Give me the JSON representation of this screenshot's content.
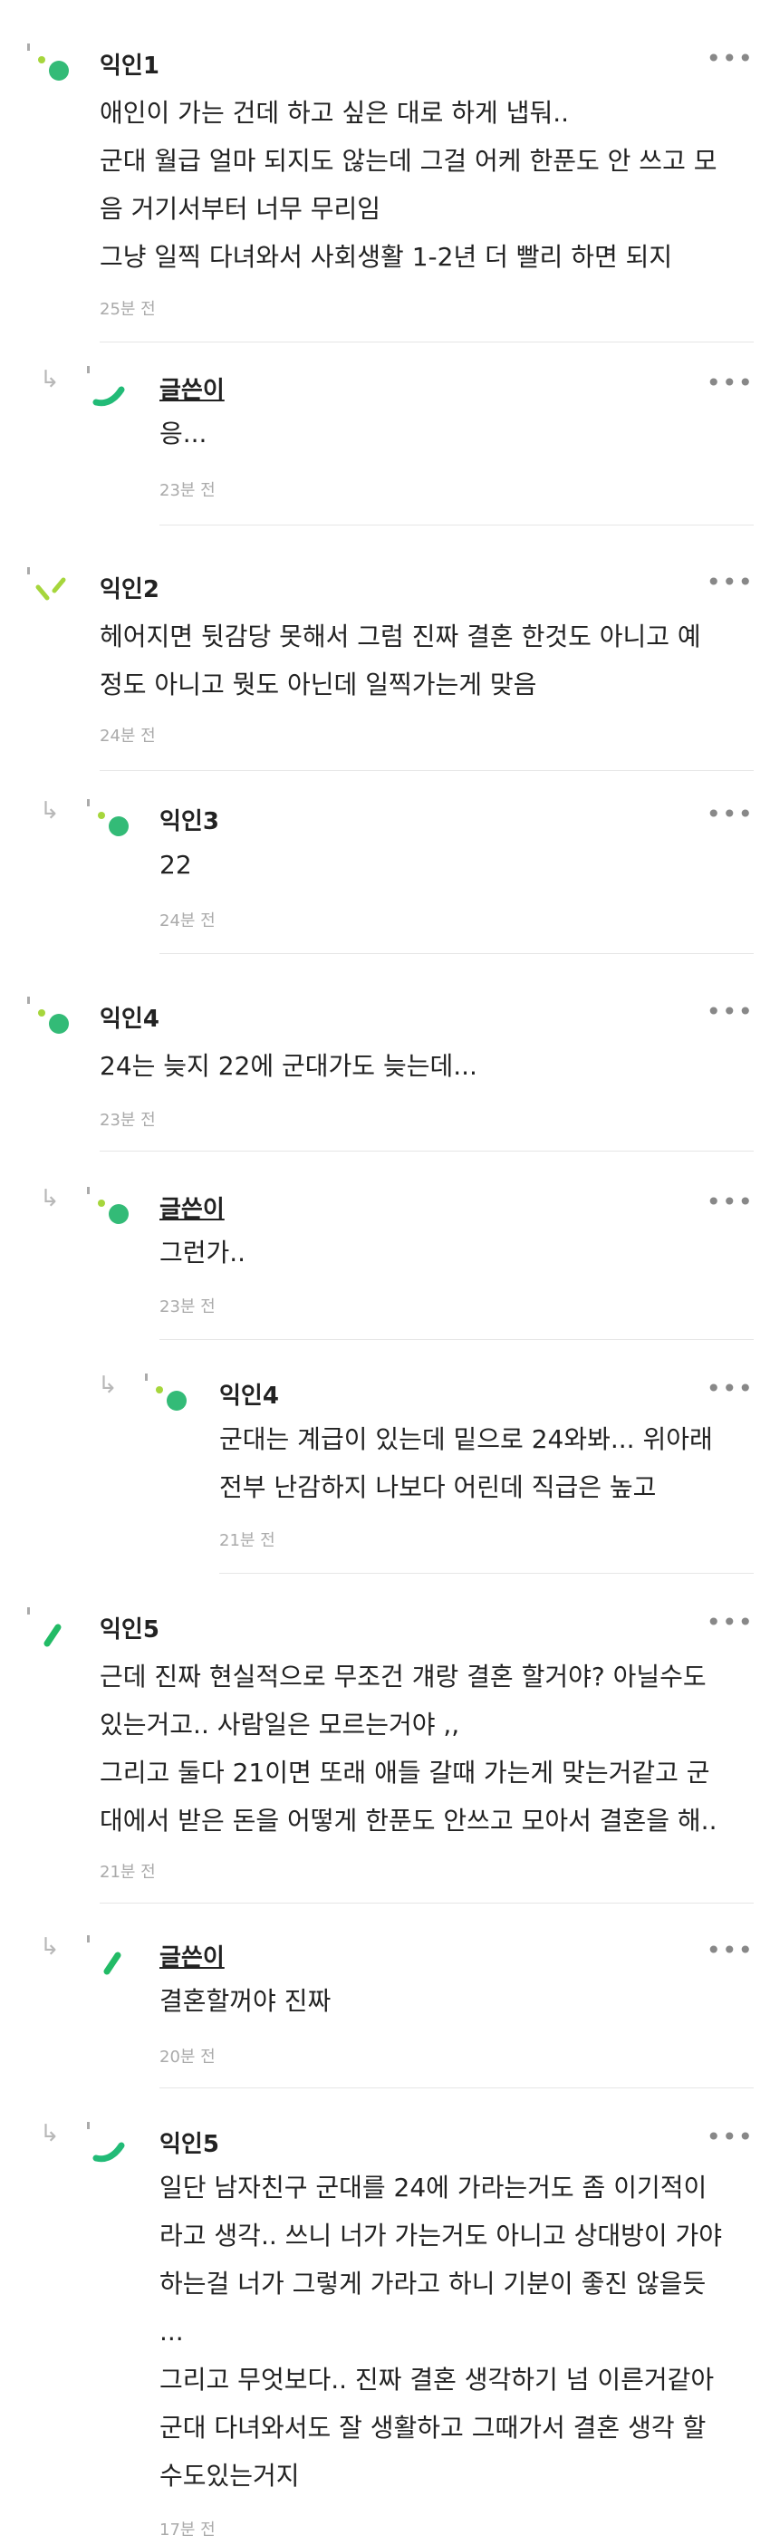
{
  "more_label": "•••",
  "reply_arrow": "↳",
  "comments": [
    {
      "author": "익인1",
      "body": "애인이 가는 건데 하고 싶은 대로 하게 냅둬..\n군대 월급 얼마 되지도 않는데 그걸 어케 한푼도 안 쓰고 모\n음 거기서부터 너무 무리임\n그냥 일찍 다녀와서 사회생활 1-2년 더 빨리 하면 되지",
      "time": "25분 전",
      "avatar": "dots"
    },
    {
      "author": "글쓴이",
      "body": "응...",
      "time": "23분 전",
      "avatar": "arc",
      "op": true
    },
    {
      "author": "익인2",
      "body": "헤어지면 뒷감당 못해서 그럼 진짜 결혼 한것도 아니고 예\n정도 아니고 뭣도 아닌데 일찍가는게 맞음",
      "time": "24분 전",
      "avatar": "ticks"
    },
    {
      "author": "익인3",
      "body": "22",
      "time": "24분 전",
      "avatar": "dots"
    },
    {
      "author": "익인4",
      "body": "24는 늦지 22에 군대가도 늦는데...",
      "time": "23분 전",
      "avatar": "dots"
    },
    {
      "author": "글쓴이",
      "body": "그런가..",
      "time": "23분 전",
      "avatar": "dots",
      "op": true
    },
    {
      "author": "익인4",
      "body": "군대는 계급이 있는데 밑으로 24와봐... 위아래\n전부 난감하지 나보다 어린데 직급은 높고",
      "time": "21분 전",
      "avatar": "dots"
    },
    {
      "author": "익인5",
      "body": "근데 진짜 현실적으로 무조건 걔랑 결혼 할거야? 아닐수도\n있는거고.. 사람일은 모르는거야 ,,\n그리고 둘다 21이면 또래 애들 갈때 가는게 맞는거같고 군\n대에서 받은 돈을 어떻게 한푼도 안쓰고 모아서 결혼을 해..",
      "time": "21분 전",
      "avatar": "slash"
    },
    {
      "author": "글쓴이",
      "body": "결혼할꺼야 진짜",
      "time": "20분 전",
      "avatar": "slash",
      "op": true
    },
    {
      "author": "익인5",
      "body": "일단 남자친구 군대를 24에 가라는거도 좀 이기적이\n라고 생각.. 쓰니 너가 가는거도 아니고 상대방이 가야\n하는걸 너가 그렇게 가라고 하니 기분이 좋진 않을듯\n...\n그리고 무엇보다.. 진짜 결혼 생각하기 넘 이른거같아\n군대 다녀와서도 잘 생활하고 그때가서 결혼 생각 할\n수도있는거지",
      "time": "17분 전",
      "avatar": "arc"
    }
  ]
}
